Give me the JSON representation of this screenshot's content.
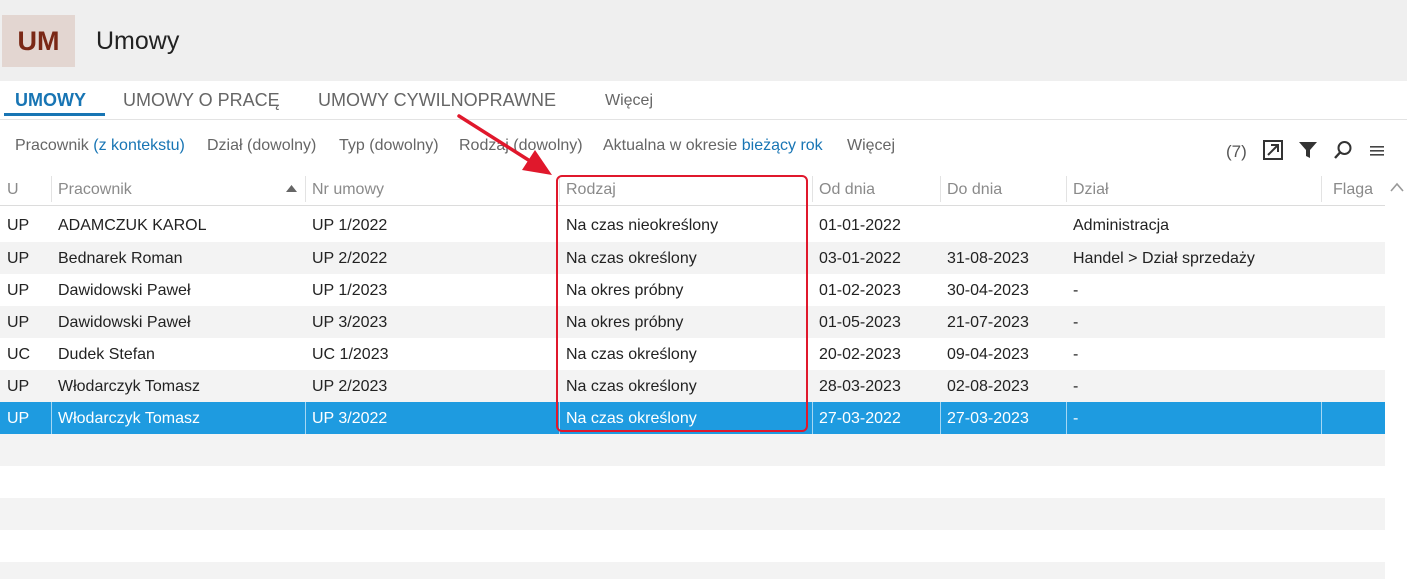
{
  "app": {
    "badge": "UM",
    "title": "Umowy"
  },
  "tabs": [
    {
      "label": "UMOWY",
      "active": true
    },
    {
      "label": "UMOWY O PRACĘ",
      "active": false
    },
    {
      "label": "UMOWY CYWILNOPRAWNE",
      "active": false
    },
    {
      "label": "Więcej",
      "active": false
    }
  ],
  "filters": {
    "pracownik": {
      "label": "Pracownik",
      "value": "(z kontekstu)"
    },
    "dzial": "Dział (dowolny)",
    "typ": "Typ (dowolny)",
    "rodzaj": "Rodzaj (dowolny)",
    "aktualna": {
      "label": "Aktualna w okresie",
      "value": "bieżący rok"
    },
    "wiecej": "Więcej",
    "count": "(7)"
  },
  "toolbar_icons": [
    "export-icon",
    "filter-icon",
    "search-icon",
    "menu-icon"
  ],
  "columns": [
    "U",
    "Pracownik",
    "Nr umowy",
    "Rodzaj",
    "Od dnia",
    "Do dnia",
    "Dział",
    "Flaga"
  ],
  "sort": {
    "column": "Pracownik",
    "direction": "asc"
  },
  "rows": [
    {
      "u": "UP",
      "pracownik": "ADAMCZUK KAROL",
      "nr": "UP 1/2022",
      "rodzaj": "Na czas nieokreślony",
      "od": "01-01-2022",
      "do": "",
      "dzial": "Administracja",
      "flaga": ""
    },
    {
      "u": "UP",
      "pracownik": "Bednarek Roman",
      "nr": "UP 2/2022",
      "rodzaj": "Na czas określony",
      "od": "03-01-2022",
      "do": "31-08-2023",
      "dzial": "Handel > Dział sprzedaży",
      "flaga": ""
    },
    {
      "u": "UP",
      "pracownik": "Dawidowski Paweł",
      "nr": "UP 1/2023",
      "rodzaj": "Na okres próbny",
      "od": "01-02-2023",
      "do": "30-04-2023",
      "dzial": "-",
      "flaga": ""
    },
    {
      "u": "UP",
      "pracownik": "Dawidowski Paweł",
      "nr": "UP 3/2023",
      "rodzaj": "Na okres próbny",
      "od": "01-05-2023",
      "do": "21-07-2023",
      "dzial": "-",
      "flaga": ""
    },
    {
      "u": "UC",
      "pracownik": "Dudek Stefan",
      "nr": "UC 1/2023",
      "rodzaj": "Na czas określony",
      "od": "20-02-2023",
      "do": "09-04-2023",
      "dzial": "-",
      "flaga": ""
    },
    {
      "u": "UP",
      "pracownik": "Włodarczyk Tomasz",
      "nr": "UP 2/2023",
      "rodzaj": "Na czas określony",
      "od": "28-03-2023",
      "do": "02-08-2023",
      "dzial": "-",
      "flaga": ""
    },
    {
      "u": "UP",
      "pracownik": "Włodarczyk Tomasz",
      "nr": "UP 3/2022",
      "rodzaj": "Na czas określony",
      "od": "27-03-2022",
      "do": "27-03-2023",
      "dzial": "-",
      "flaga": ""
    }
  ],
  "selected_row": 6,
  "colors": {
    "accent": "#1875b4",
    "selection": "#1e9be0",
    "annotation": "#e0182c",
    "badge_bg": "#e3d6d1",
    "badge_text": "#7a2816"
  }
}
